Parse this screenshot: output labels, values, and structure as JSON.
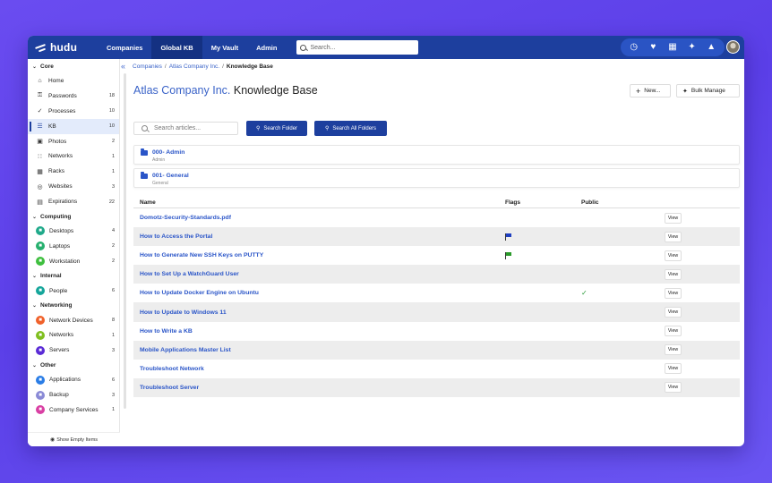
{
  "app": {
    "logo_text": "hudu",
    "nav_tabs": [
      "Companies",
      "Global KB",
      "My Vault",
      "Admin"
    ],
    "active_tab": "Global KB",
    "search_placeholder": "Search..."
  },
  "top_icons": [
    "clock-icon",
    "heart-icon",
    "calendar-icon",
    "tools-icon",
    "graduation-cap-icon"
  ],
  "sidebar": {
    "sections": [
      {
        "title": "Core",
        "items": [
          {
            "label": "Home",
            "icon": "home-icon",
            "count": ""
          },
          {
            "label": "Passwords",
            "icon": "key-icon",
            "count": "18"
          },
          {
            "label": "Processes",
            "icon": "check-icon",
            "count": "10"
          },
          {
            "label": "KB",
            "icon": "kb-icon",
            "count": "10",
            "active": true
          },
          {
            "label": "Photos",
            "icon": "camera-icon",
            "count": "2"
          },
          {
            "label": "Networks",
            "icon": "network-icon",
            "count": "1"
          },
          {
            "label": "Racks",
            "icon": "rack-icon",
            "count": "1"
          },
          {
            "label": "Websites",
            "icon": "globe-icon",
            "count": "3"
          },
          {
            "label": "Expirations",
            "icon": "calendar-icon",
            "count": "22"
          }
        ]
      },
      {
        "title": "Computing",
        "items": [
          {
            "label": "Desktops",
            "icon": "desktop-icon",
            "count": "4",
            "color": "#1fa98a"
          },
          {
            "label": "Laptops",
            "icon": "laptop-icon",
            "count": "2",
            "color": "#26b06e"
          },
          {
            "label": "Workstation",
            "icon": "workstation-icon",
            "count": "2",
            "color": "#3fbf3f"
          }
        ]
      },
      {
        "title": "Internal",
        "items": [
          {
            "label": "People",
            "icon": "person-icon",
            "count": "6",
            "color": "#14a59a"
          }
        ]
      },
      {
        "title": "Networking",
        "items": [
          {
            "label": "Network Devices",
            "icon": "network-devices-icon",
            "count": "8",
            "color": "#f0612a"
          },
          {
            "label": "Networks",
            "icon": "networks-icon",
            "count": "1",
            "color": "#7fbf1f"
          },
          {
            "label": "Servers",
            "icon": "servers-icon",
            "count": "3",
            "color": "#5a2bd6"
          }
        ]
      },
      {
        "title": "Other",
        "items": [
          {
            "label": "Applications",
            "icon": "applications-icon",
            "count": "6",
            "color": "#2a7de6"
          },
          {
            "label": "Backup",
            "icon": "backup-icon",
            "count": "3",
            "color": "#8a8ad6"
          },
          {
            "label": "Company Services",
            "icon": "company-services-icon",
            "count": "1",
            "color": "#d93fa3"
          }
        ]
      }
    ],
    "footer": "Show Empty Items"
  },
  "breadcrumb": {
    "items": [
      "Companies",
      "Atlas Company Inc."
    ],
    "current": "Knowledge Base"
  },
  "page": {
    "company": "Atlas Company Inc.",
    "title_suffix": "Knowledge Base",
    "new_button": "New...",
    "bulk_button": "Bulk Manage",
    "search_placeholder": "Search articles...",
    "search_folder_button": "Search Folder",
    "search_all_button": "Search All Folders"
  },
  "folders": [
    {
      "name": "000- Admin",
      "subtitle": "Admin"
    },
    {
      "name": "001- General",
      "subtitle": "General"
    }
  ],
  "table": {
    "columns": [
      "Name",
      "Flags",
      "Public"
    ],
    "view_label": "View",
    "rows": [
      {
        "name": "Domotz-Security-Standards.pdf",
        "flag": "",
        "public": false
      },
      {
        "name": "How to Access the Portal",
        "flag": "#1f3fc0",
        "public": false
      },
      {
        "name": "How to Generate New SSH Keys on PUTTY",
        "flag": "#2a9a2a",
        "public": false
      },
      {
        "name": "How to Set Up a WatchGuard User",
        "flag": "",
        "public": false
      },
      {
        "name": "How to Update Docker Engine on Ubuntu",
        "flag": "",
        "public": true
      },
      {
        "name": "How to Update to Windows 11",
        "flag": "",
        "public": false
      },
      {
        "name": "How to Write a KB",
        "flag": "",
        "public": false
      },
      {
        "name": "Mobile Applications Master List",
        "flag": "",
        "public": false
      },
      {
        "name": "Troubleshoot Network",
        "flag": "",
        "public": false
      },
      {
        "name": "Troubleshoot Server",
        "flag": "",
        "public": false
      }
    ]
  }
}
